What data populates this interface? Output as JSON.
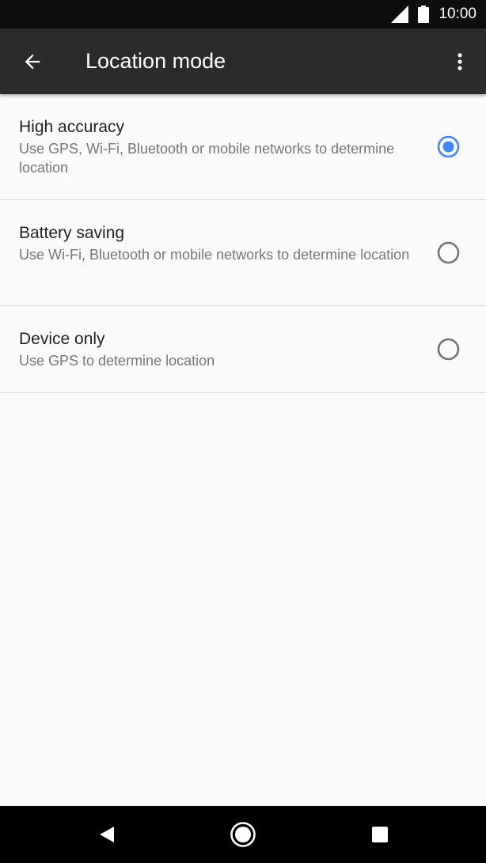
{
  "status_bar": {
    "time": "10:00",
    "icons": [
      "cell-signal-icon",
      "battery-icon"
    ]
  },
  "app_bar": {
    "title": "Location mode",
    "back_icon": "arrow-back-icon",
    "more_icon": "more-vert-icon"
  },
  "options": [
    {
      "label": "High accuracy",
      "description": "Use GPS, Wi-Fi, Bluetooth or mobile networks to determine location",
      "selected": true
    },
    {
      "label": "Battery saving",
      "description": "Use Wi-Fi, Bluetooth or mobile networks to determine location",
      "selected": false
    },
    {
      "label": "Device only",
      "description": "Use GPS to determine location",
      "selected": false
    }
  ],
  "nav_bar": {
    "icons": [
      "back-triangle-icon",
      "home-circle-icon",
      "recents-square-icon"
    ]
  },
  "colors": {
    "accent": "#4285f4",
    "app_bar": "#2b2b2b",
    "status_bar": "#0e0e0e",
    "background": "#fafafa",
    "radio_unselected": "#757575"
  }
}
